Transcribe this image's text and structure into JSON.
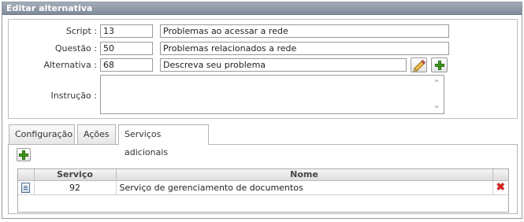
{
  "window": {
    "title": "Editar alternativa"
  },
  "form": {
    "script": {
      "label": "Script :",
      "id": "13",
      "name": "Problemas ao acessar a rede"
    },
    "questao": {
      "label": "Questão :",
      "id": "50",
      "name": "Problemas relacionados a rede"
    },
    "alternativa": {
      "label": "Alternativa :",
      "id": "68",
      "name": "Descreva seu problema"
    },
    "instrucao": {
      "label": "Instrução :",
      "value": ""
    }
  },
  "tabs": [
    {
      "label": "Configuração",
      "active": false
    },
    {
      "label": "Ações",
      "active": false
    },
    {
      "label": "Serviços adicionais",
      "active": true
    }
  ],
  "grid": {
    "columns": [
      "",
      "Serviço",
      "Nome",
      ""
    ],
    "rows": [
      {
        "servico": "92",
        "nome": "Serviço de gerenciamento de documentos"
      }
    ]
  },
  "icons": {
    "edit": "pencil-icon",
    "add": "plus-icon",
    "row": "document-icon",
    "delete": "delete-x-icon"
  },
  "colors": {
    "titlebar": "#8f9aa6",
    "plus": "#3f9a1f",
    "delete": "#d42020"
  }
}
